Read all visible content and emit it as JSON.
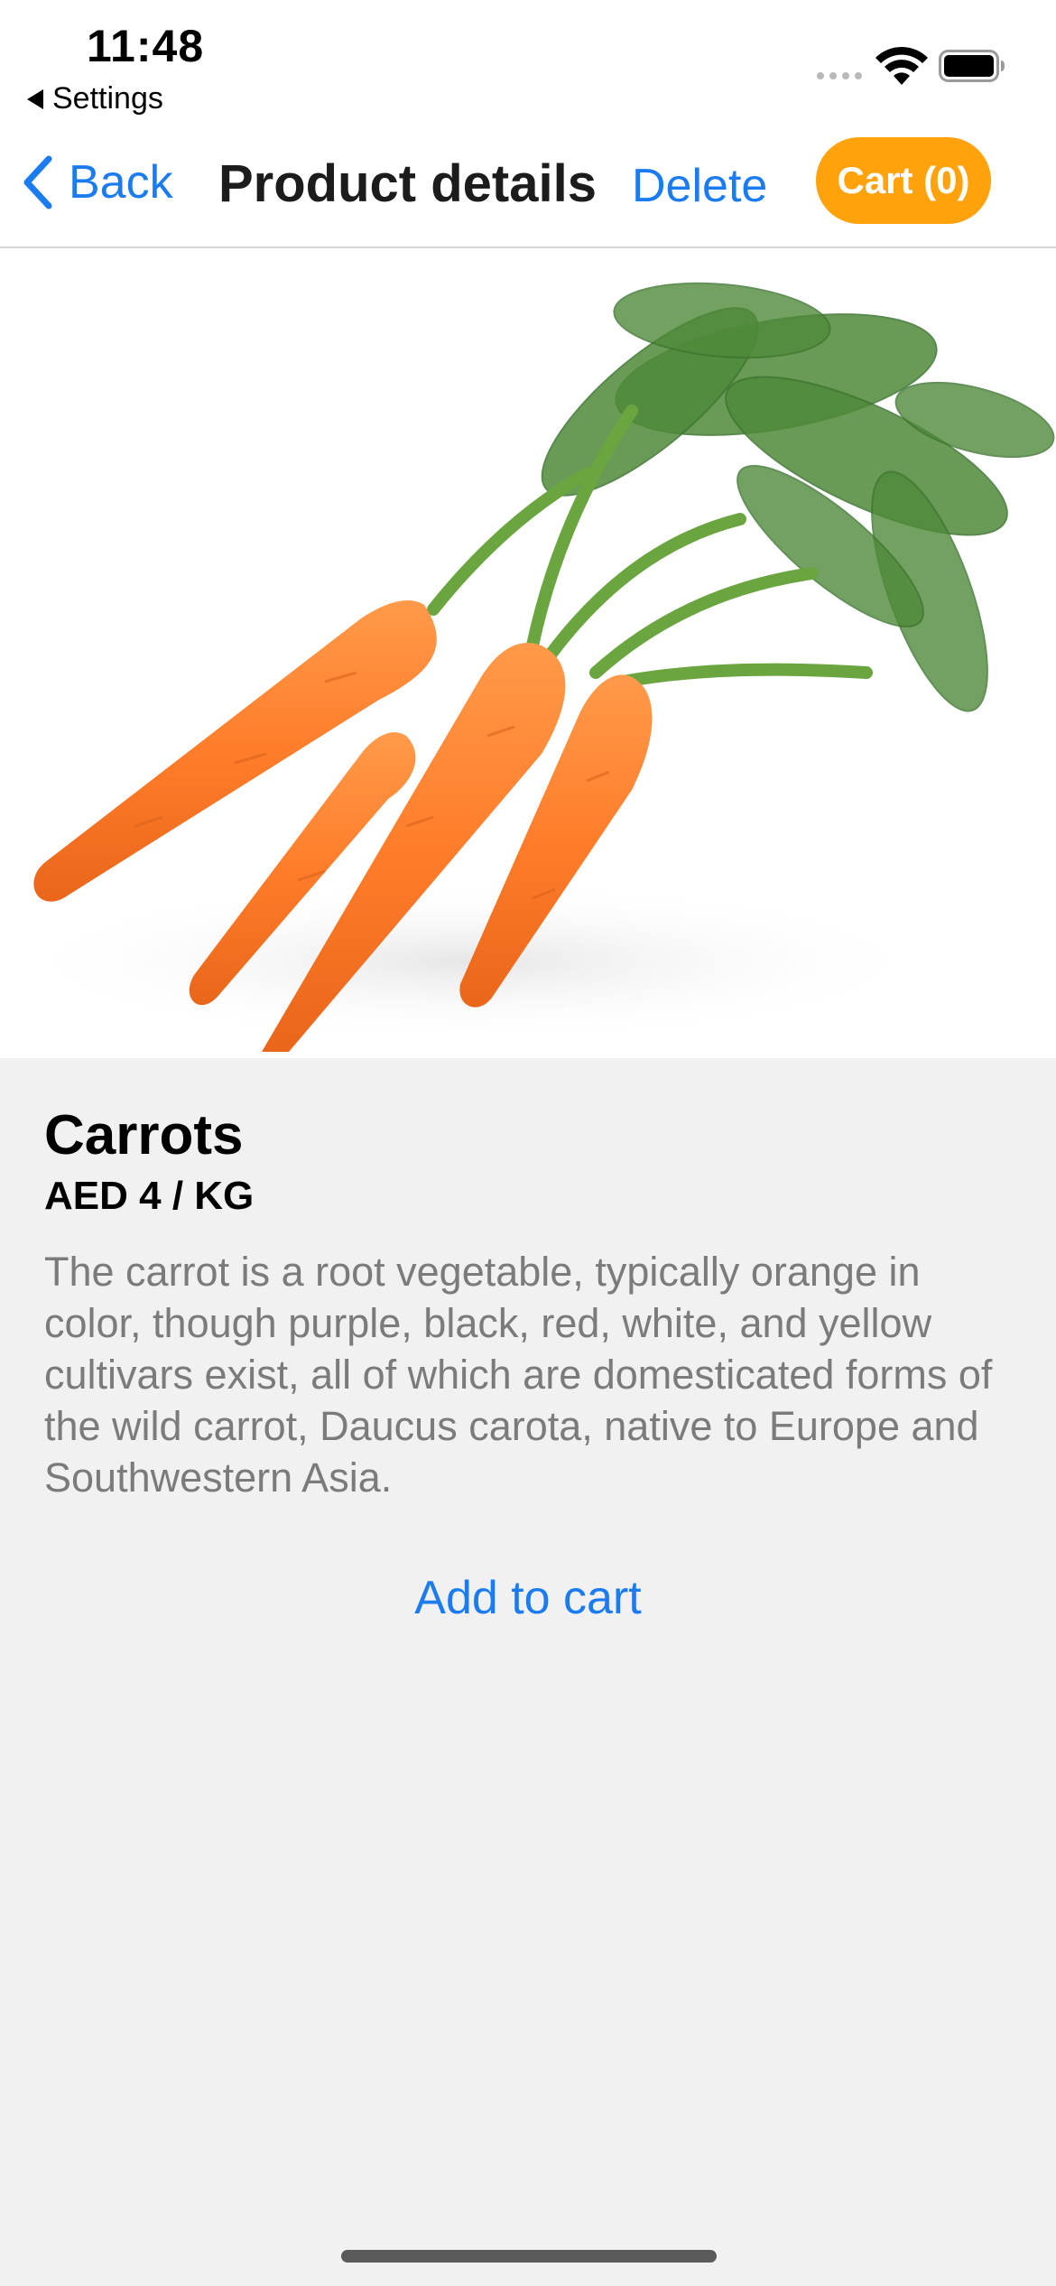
{
  "status_bar": {
    "time": "11:48",
    "back_app": "Settings",
    "icons": [
      "cellular-signal-icon",
      "wifi-icon",
      "battery-icon"
    ]
  },
  "nav": {
    "back_label": "Back",
    "title": "Product details",
    "delete_label": "Delete",
    "cart_label": "Cart (0)"
  },
  "product": {
    "image_subject": "carrots-image",
    "name": "Carrots",
    "price": "AED 4 / KG",
    "description": "The carrot is a root vegetable, typically orange in color, though purple, black, red, white, and yellow cultivars exist, all of which are domesticated forms of the wild carrot, Daucus carota, native to Europe and Southwestern Asia.",
    "add_to_cart_label": "Add to cart"
  },
  "colors": {
    "accent_blue": "#1a7cf0",
    "cart_orange": "#ffa20b",
    "background": "#f1f1f1",
    "description_gray": "#7b7b7b"
  }
}
